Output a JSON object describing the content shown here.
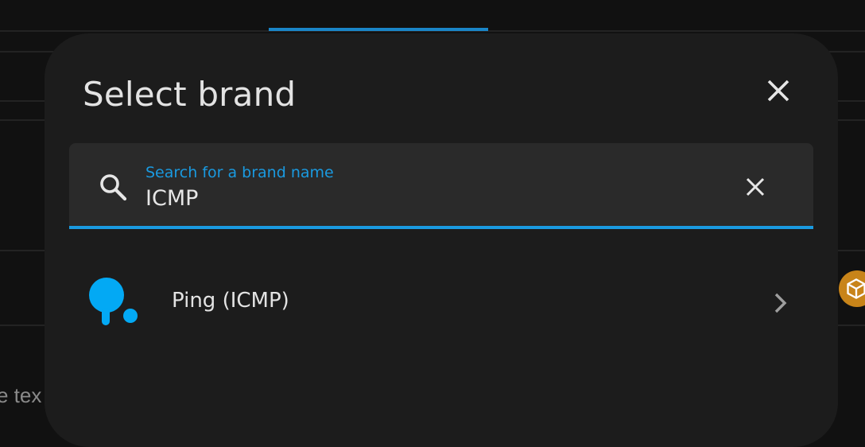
{
  "background": {
    "partial_text": "e tex"
  },
  "dialog": {
    "title": "Select brand",
    "close_icon": "close-icon",
    "search": {
      "label": "Search for a brand name",
      "value": "ICMP",
      "search_icon": "search-icon",
      "clear_icon": "clear-icon"
    },
    "results": [
      {
        "name": "Ping (ICMP)",
        "logo": "ping-pong-icon",
        "chevron": "chevron-right-icon"
      }
    ]
  },
  "colors": {
    "accent": "#1a9ae0",
    "brand_logo": "#03a9f4",
    "dialog_bg": "#1c1c1c",
    "page_bg": "#111111",
    "badge": "#c88419"
  }
}
